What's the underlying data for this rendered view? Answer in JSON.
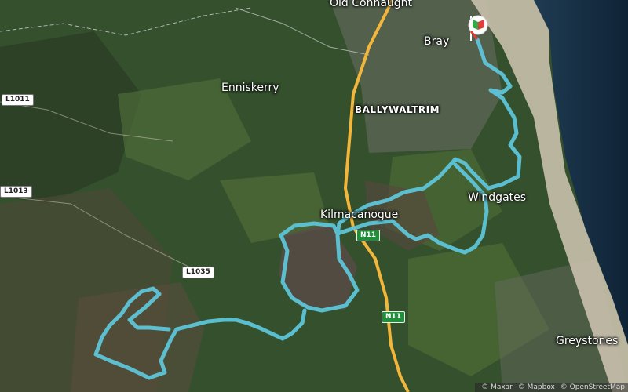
{
  "map": {
    "places": {
      "old_connaught": "Old Connaught",
      "bray": "Bray",
      "enniskerry": "Enniskerry",
      "ballywaltrim": "BALLYWALTRIM",
      "kilmacanogue": "Kilmacanogue",
      "windgates": "Windgates",
      "greystones": "Greystones"
    },
    "roads": {
      "l1011": "L1011",
      "l1013": "L1013",
      "l1035": "L1035",
      "n11_upper": "N11",
      "n11_lower": "N11"
    },
    "route_color": "#5ec4d8",
    "road_color": "#f2b63a",
    "flag_colors": [
      "#e0403a",
      "#2faa4a",
      "#ffffff"
    ],
    "attribution": [
      "© Maxar",
      "© Mapbox",
      "© OpenStreetMap"
    ]
  }
}
